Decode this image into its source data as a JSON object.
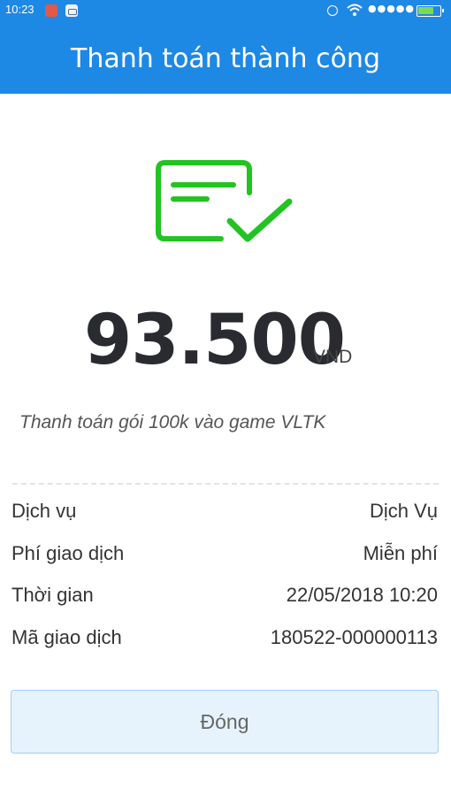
{
  "status_bar": {
    "time": "10:23",
    "signal": "●●●●●"
  },
  "header": {
    "title": "Thanh toán thành công"
  },
  "success_icon": "receipt-check-icon",
  "payment": {
    "amount": "93.500",
    "currency": "VND",
    "description": "Thanh toán gói 100k vào game VLTK"
  },
  "details": [
    {
      "label": "Dịch vụ",
      "value": "Dịch Vụ"
    },
    {
      "label": "Phí giao dịch",
      "value": "Miễn phí"
    },
    {
      "label": "Thời gian",
      "value": "22/05/2018 10:20"
    },
    {
      "label": "Mã giao dịch",
      "value": "180522-000000113"
    }
  ],
  "close_button": {
    "label": "Đóng"
  },
  "colors": {
    "header": "#1e88e5",
    "success": "#22c322",
    "button_bg": "#e6f3fd",
    "button_border": "#9fcff3"
  }
}
